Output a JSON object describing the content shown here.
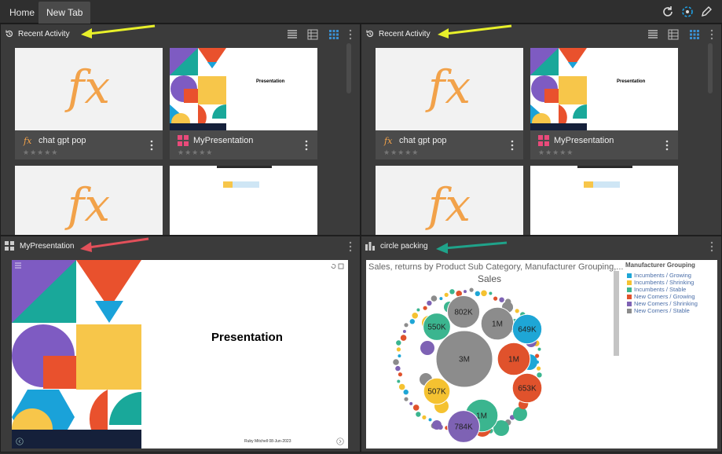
{
  "tabs": [
    {
      "label": "Home"
    },
    {
      "label": "New Tab"
    }
  ],
  "panels": {
    "recent_left": {
      "title": "Recent Activity",
      "cards": [
        {
          "name": "chat gpt pop",
          "type": "fx-icon"
        },
        {
          "name": "MyPresentation",
          "type": "presentation-icon"
        }
      ]
    },
    "recent_right": {
      "title": "Recent Activity",
      "cards": [
        {
          "name": "chat gpt pop",
          "type": "fx-icon"
        },
        {
          "name": "MyPresentation",
          "type": "presentation-icon"
        }
      ]
    },
    "presentation": {
      "title": "MyPresentation",
      "slide_title": "Presentation",
      "footer": "Ruby Mitchell 08-Jun-2023"
    },
    "chart": {
      "title": "circle packing"
    }
  },
  "thumb": {
    "fx_glyph": "fx",
    "pres_title": "Presentation",
    "stars": "★★★★★"
  },
  "colors": {
    "accent_blue": "#1ea1e6",
    "arrow_yellow": "#e8f02a",
    "arrow_red": "#e2505a",
    "arrow_teal": "#1fa38a"
  },
  "chart_data": {
    "type": "circle-packing",
    "title": "Sales, returns by Product Sub Category, Manufacturer Grouping,...",
    "subtitle": "Sales",
    "legend_title": "Manufacturer Grouping",
    "legend": [
      {
        "name": "Incumbents / Growing",
        "color": "#1ea6d6"
      },
      {
        "name": "Incumbents / Shrinking",
        "color": "#f5c231"
      },
      {
        "name": "Incumbents / Stable",
        "color": "#3bb58f"
      },
      {
        "name": "New Comers / Growing",
        "color": "#e0522c"
      },
      {
        "name": "New Comers / Shrinking",
        "color": "#7e62b4"
      },
      {
        "name": "New Comers / Stable",
        "color": "#8c8c8c"
      }
    ],
    "bubbles": [
      {
        "label": "3M",
        "value": 3000000,
        "group": "New Comers / Stable"
      },
      {
        "label": "1M",
        "value": 1000000,
        "group": "New Comers / Growing"
      },
      {
        "label": "1M",
        "value": 1000000,
        "group": "Incumbents / Stable"
      },
      {
        "label": "1M",
        "value": 1000000,
        "group": "New Comers / Stable"
      },
      {
        "label": "802K",
        "value": 802000,
        "group": "New Comers / Stable"
      },
      {
        "label": "784K",
        "value": 784000,
        "group": "New Comers / Shrinking"
      },
      {
        "label": "649K",
        "value": 649000,
        "group": "Incumbents / Growing"
      },
      {
        "label": "653K",
        "value": 653000,
        "group": "New Comers / Growing"
      },
      {
        "label": "550K",
        "value": 550000,
        "group": "Incumbents / Stable"
      },
      {
        "label": "507K",
        "value": 507000,
        "group": "Incumbents / Shrinking"
      }
    ]
  }
}
